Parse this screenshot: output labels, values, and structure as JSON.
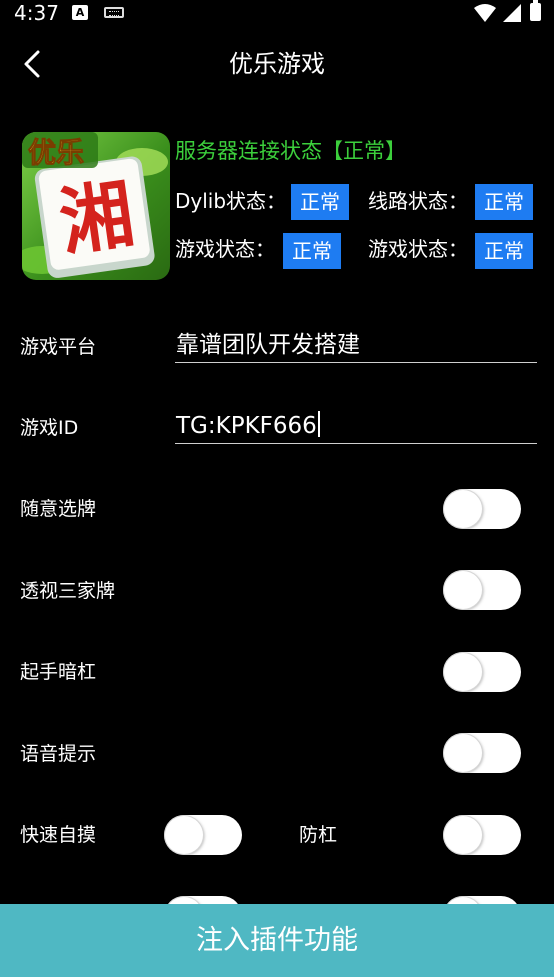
{
  "status_bar": {
    "time": "4:37",
    "notification_icon_letter": "A"
  },
  "toolbar": {
    "title": "优乐游戏"
  },
  "app": {
    "logo_text_top": "优乐",
    "logo_text_main": "湘",
    "server_status": "服务器连接状态【正常】",
    "server_status_color": "#3ccf3c",
    "badge_color": "#1e7cf2",
    "stats": [
      {
        "label": "Dylib状态：",
        "value": "正常"
      },
      {
        "label": "线路状态：",
        "value": "正常"
      },
      {
        "label": "游戏状态：",
        "value": "正常"
      },
      {
        "label": "游戏状态：",
        "value": "正常"
      }
    ]
  },
  "form": {
    "platform": {
      "label": "游戏平台",
      "value": "靠谱团队开发搭建"
    },
    "game_id": {
      "label": "游戏ID",
      "value": "TG:KPKF666"
    }
  },
  "toggles": [
    {
      "label": "随意选牌",
      "on": false
    },
    {
      "label": "透视三家牌",
      "on": false
    },
    {
      "label": "起手暗杠",
      "on": false
    },
    {
      "label": "语音提示",
      "on": false
    },
    {
      "label": "快速自摸",
      "on": false
    },
    {
      "label": "防杠",
      "on": false
    }
  ],
  "inject_button": {
    "label": "注入插件功能",
    "color": "#4fb8c3"
  }
}
